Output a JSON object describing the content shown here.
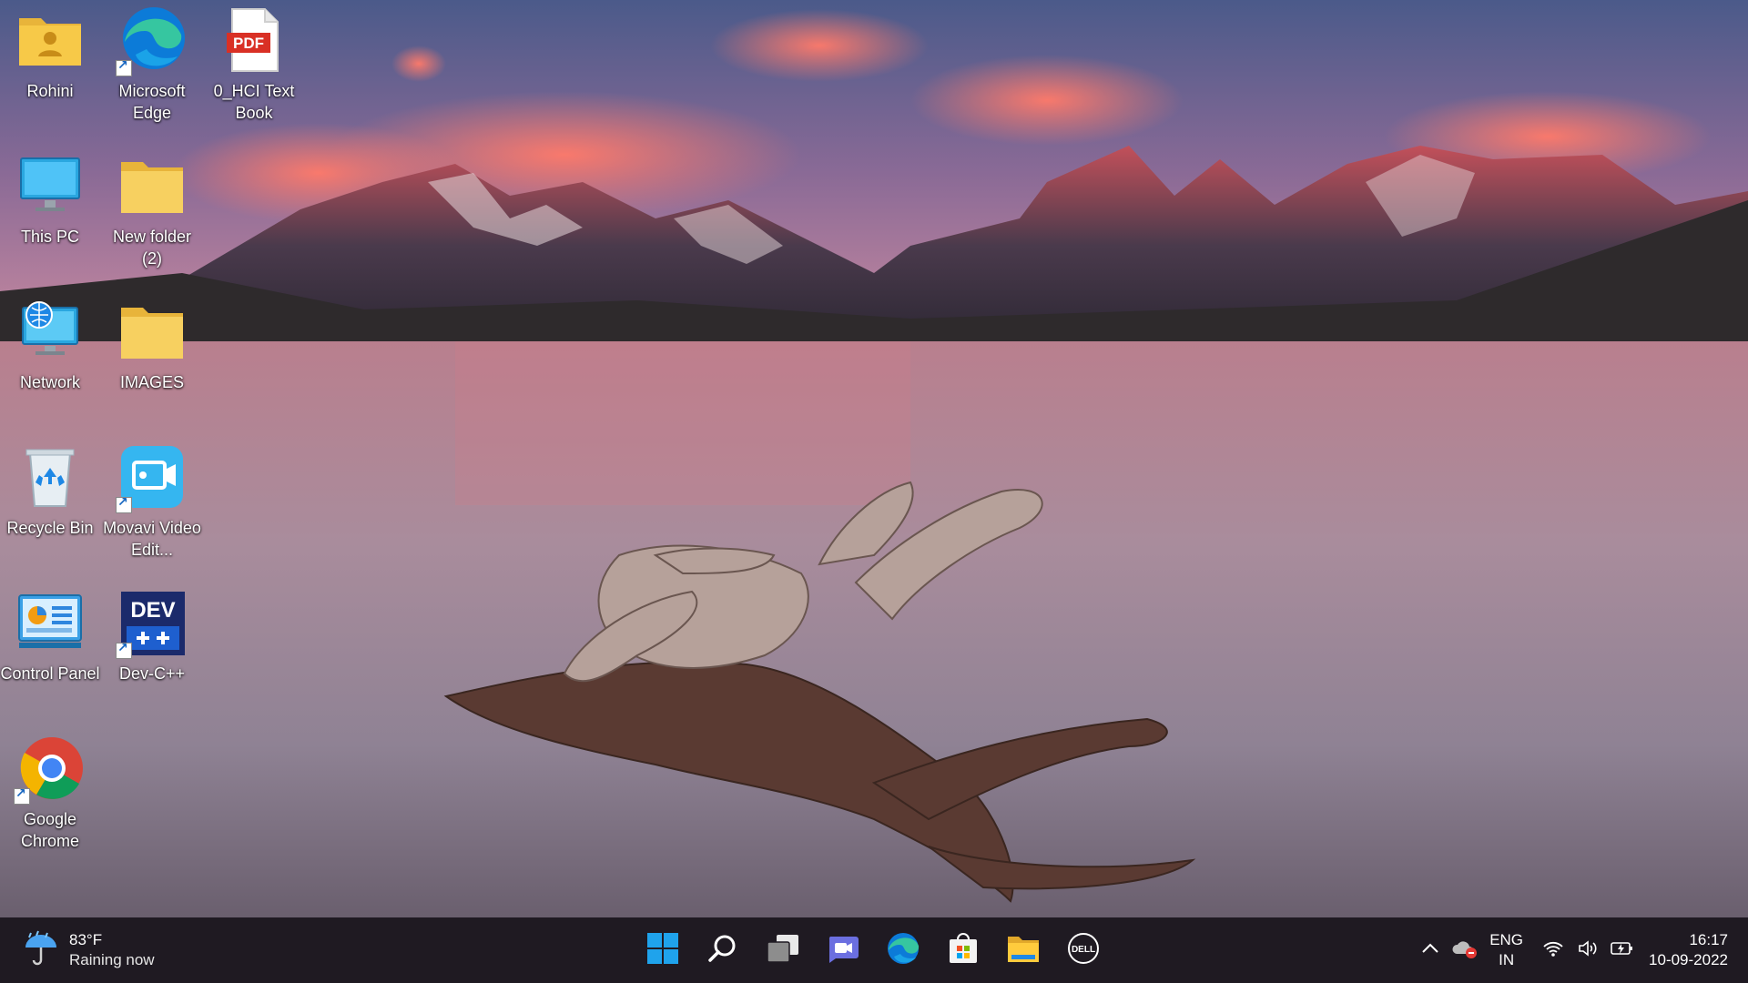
{
  "desktop": {
    "icons": [
      {
        "label": "Rohini",
        "icon": "user-folder-icon"
      },
      {
        "label": "Microsoft Edge",
        "icon": "edge-icon"
      },
      {
        "label": "0_HCI Text Book",
        "icon": "pdf-icon",
        "badge": "PDF"
      },
      {
        "label": "This PC",
        "icon": "this-pc-icon"
      },
      {
        "label": "New folder (2)",
        "icon": "folder-icon"
      },
      {
        "label": "Network",
        "icon": "network-icon"
      },
      {
        "label": "IMAGES",
        "icon": "folder-icon"
      },
      {
        "label": "Recycle Bin",
        "icon": "recycle-bin-icon"
      },
      {
        "label": "Movavi Video Edit...",
        "icon": "movavi-icon"
      },
      {
        "label": "Control Panel",
        "icon": "control-panel-icon"
      },
      {
        "label": "Dev-C++",
        "icon": "dev-cpp-icon",
        "badge": "DEV"
      },
      {
        "label": "Google Chrome",
        "icon": "chrome-icon"
      }
    ]
  },
  "taskbar": {
    "weather": {
      "temp": "83°F",
      "condition": "Raining now",
      "icon": "rain-umbrella-icon"
    },
    "apps": [
      "start-icon",
      "search-icon",
      "task-view-icon",
      "teams-chat-icon",
      "edge-icon",
      "store-icon",
      "file-explorer-icon",
      "dell-icon"
    ],
    "dell_text": "DELL",
    "tray": {
      "language_line1": "ENG",
      "language_line2": "IN",
      "time": "16:17",
      "date": "10-09-2022"
    }
  },
  "colors": {
    "taskbar_bg": "#1f1a22",
    "folder_yellow": "#f7c948",
    "accent_blue": "#0a74da"
  }
}
